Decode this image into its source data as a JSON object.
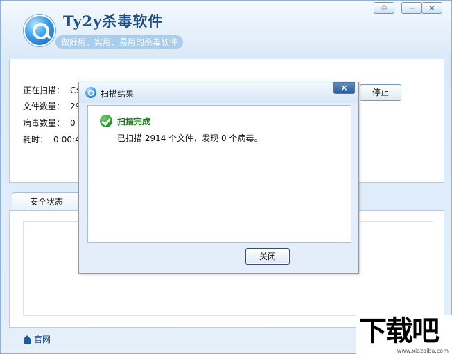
{
  "app": {
    "title": "Ty2y杀毒软件",
    "slogan": "做好用、实用、易用的杀毒软件"
  },
  "window_controls": {
    "skin": "♲",
    "minimize": "−",
    "close": "×"
  },
  "scan": {
    "rows": [
      {
        "label": "正在扫描：",
        "value": "C:\\"
      },
      {
        "label": "文件数量：",
        "value": "291"
      },
      {
        "label": "病毒数量：",
        "value": "0"
      },
      {
        "label": "耗时：",
        "value": "0:00:45"
      }
    ],
    "stop_label": "停止"
  },
  "tabs": {
    "security_status": "安全状态"
  },
  "footer": {
    "homepage_label": "官网"
  },
  "dialog": {
    "title": "扫描结果",
    "close_glyph": "×",
    "status_title": "扫描完成",
    "message": "已扫描 2914 个文件，发现 0 个病毒。",
    "button_label": "关闭"
  },
  "watermark": {
    "logo": "下载吧",
    "url": "www.xiazaiba.com"
  },
  "colors": {
    "accent": "#1d4f86",
    "success": "#1f7d1f",
    "panel_border": "#b6cde4"
  }
}
